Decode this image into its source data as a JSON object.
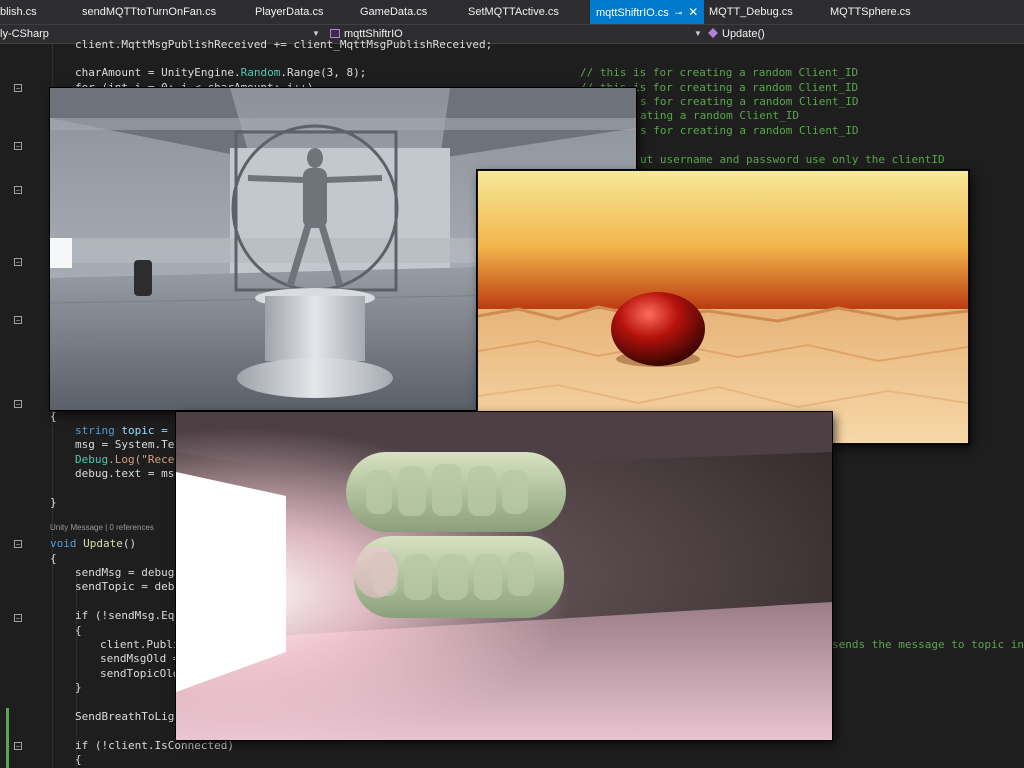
{
  "tabs": [
    {
      "label": "blish.cs",
      "active": false
    },
    {
      "label": "sendMQTTtoTurnOnFan.cs",
      "active": false
    },
    {
      "label": "PlayerData.cs",
      "active": false
    },
    {
      "label": "GameData.cs",
      "active": false
    },
    {
      "label": "SetMQTTActive.cs",
      "active": false
    },
    {
      "label": "mqttShiftrIO.cs",
      "active": true
    },
    {
      "label": "MQTT_Debug.cs",
      "active": false
    },
    {
      "label": "MQTTSphere.cs",
      "active": false
    }
  ],
  "nav": {
    "project": "ly-CSharp",
    "class": "mqttShiftrIO",
    "member": "Update()"
  },
  "code": {
    "l0": "client.MqttMsgPublishReceived += client_MqttMsgPublishReceived;",
    "l1_a": "charAmount = UnityEngine.",
    "l1_b": "Random",
    "l1_c": ".Range(3, 8);",
    "l2": "for (int i = 0; i < charAmount; i++)",
    "c1": "// this is for creating a random Client_ID",
    "c2": "// this is for creating a random Client_ID",
    "c3": "s for creating a random Client_ID",
    "c4": "ating a random Client_ID",
    "c5": "s for creating a random Client_ID",
    "c6": "ut username and password use only the clientID",
    "brace_open": "{",
    "topic_kw": "string",
    "topic_rest": " topic = e",
    "msg_line": "msg = System.Tex",
    "debuglog_a": "Debug",
    "debuglog_b": ".Log(\"Recei",
    "debugtext": "debug.text = msg",
    "brace_close": "}",
    "codelens": "Unity Message | 0 references",
    "update_kw": "void",
    "update_name": "Update",
    "update_parens": "()",
    "sendmsg": "sendMsg = debug.",
    "sendtopic": "sendTopic = debu",
    "if_send": "if (!sendMsg.Equ",
    "publi": "client.Publi",
    "sendmsgold": "sendMsgOld =",
    "sendtopicold": "sendTopicOld",
    "sendbreath": "SendBreathToLigh",
    "if_connected": "if (!client.IsConnected)",
    "sends_comment": "sends the message to topic in C"
  },
  "colors": {
    "editor_bg": "#1e1e1e",
    "tab_active": "#007acc",
    "keyword": "#569cd6",
    "comment": "#57a64a"
  },
  "icons": [
    "pin-icon",
    "close-icon",
    "chevron-down-icon",
    "class-icon",
    "method-icon",
    "fold-icon"
  ]
}
